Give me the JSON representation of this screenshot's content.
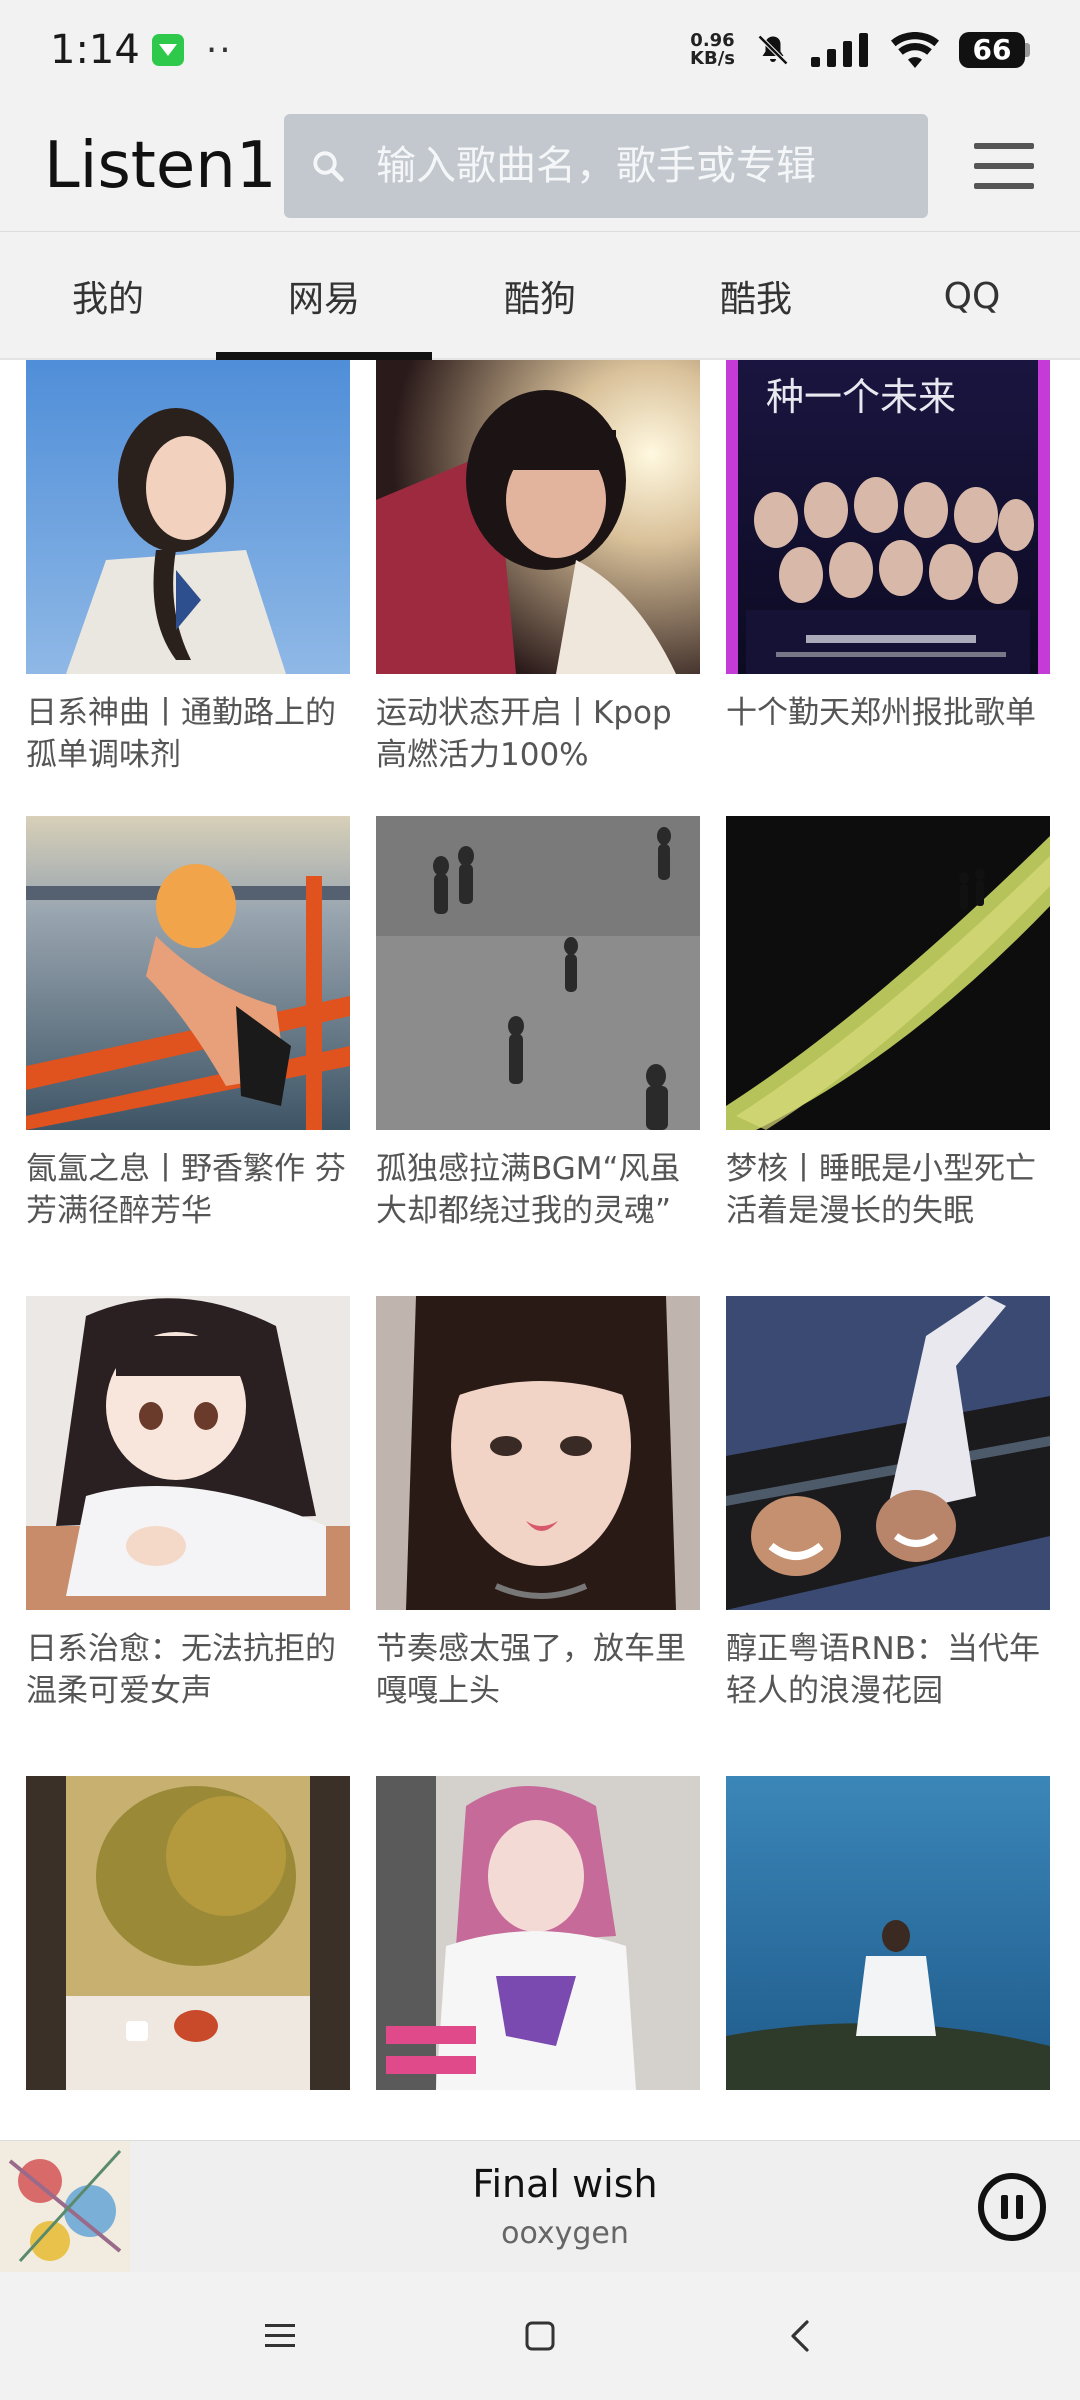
{
  "status_bar": {
    "time": "1:14",
    "dots": "··",
    "net_speed_value": "0.96",
    "net_speed_unit": "KB/s",
    "battery": "66",
    "icons": [
      "app-notification-icon",
      "mute-bell-icon",
      "signal-icon",
      "wifi-icon",
      "battery-icon"
    ]
  },
  "header": {
    "title": "Listen1",
    "search_placeholder": "输入歌曲名，歌手或专辑",
    "search_value": ""
  },
  "tabs": [
    {
      "label": "我的",
      "active": false
    },
    {
      "label": "网易",
      "active": true
    },
    {
      "label": "酷狗",
      "active": false
    },
    {
      "label": "酷我",
      "active": false
    },
    {
      "label": "QQ",
      "active": false
    }
  ],
  "playlists": [
    {
      "title": "日系神曲丨通勤路上的孤单调味剂",
      "cover": "girl-blue-sky"
    },
    {
      "title": "运动状态开启丨Kpop高燃活力100%",
      "cover": "girl-sunlight-red"
    },
    {
      "title": "十个勤天郑州报批歌单",
      "cover": "boy-group-poster"
    },
    {
      "title": "氤氲之息丨野香繁作 芬芳满径醉芳华",
      "cover": "girl-boat-railing"
    },
    {
      "title": "孤独感拉满BGM“风虽大却都绕过我的灵魂”",
      "cover": "people-gray-street"
    },
    {
      "title": "梦核丨睡眠是小型死亡 活着是漫长的失眠",
      "cover": "glowing-path-night"
    },
    {
      "title": "日系治愈：无法抗拒的温柔可爱女声",
      "cover": "anime-girl"
    },
    {
      "title": "节奏感太强了，放车里嘎嘎上头",
      "cover": "girl-selfie"
    },
    {
      "title": "醇正粤语RNB：当代年轻人的浪漫花园",
      "cover": "two-boys-laughing"
    },
    {
      "title": "",
      "cover": "window-autumn-tree"
    },
    {
      "title": "",
      "cover": "pink-hair-girl"
    },
    {
      "title": "",
      "cover": "man-by-sea"
    }
  ],
  "player": {
    "title": "Final wish",
    "artist": "ooxygen",
    "state": "playing"
  },
  "nav": [
    "menu-nav-icon",
    "home-nav-icon",
    "back-nav-icon"
  ]
}
